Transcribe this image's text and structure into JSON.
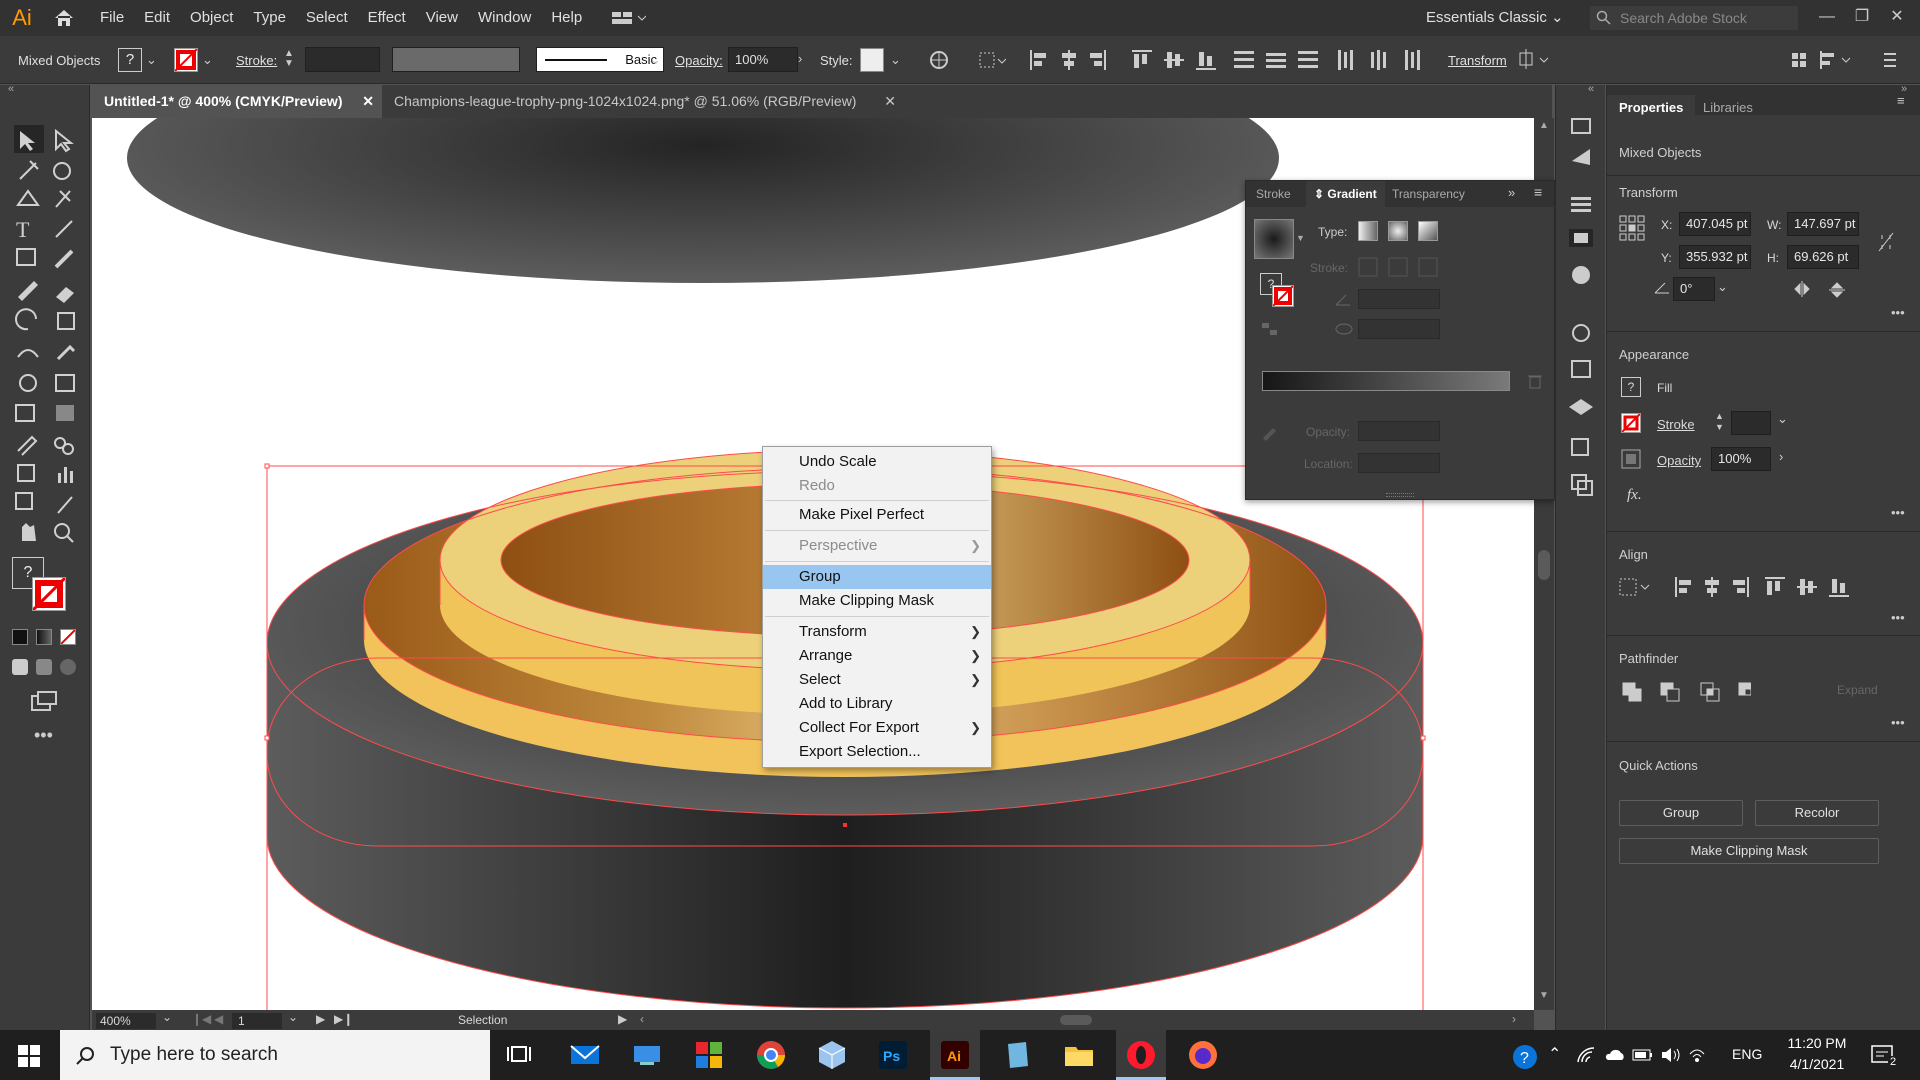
{
  "app": {
    "logo": "Ai"
  },
  "menubar": {
    "items": [
      "File",
      "Edit",
      "Object",
      "Type",
      "Select",
      "Effect",
      "View",
      "Window",
      "Help"
    ],
    "workspace": "Essentials Classic",
    "search_placeholder": "Search Adobe Stock"
  },
  "control_bar": {
    "selection": "Mixed Objects",
    "fill": "?",
    "stroke_label": "Stroke:",
    "brush": "Basic",
    "opacity_label": "Opacity:",
    "opacity": "100%",
    "style_label": "Style:",
    "transform": "Transform"
  },
  "tabs": [
    {
      "label": "Untitled-1* @ 400% (CMYK/Preview)",
      "active": true
    },
    {
      "label": "Champions-league-trophy-png-1024x1024.png* @ 51.06% (RGB/Preview)",
      "active": false
    }
  ],
  "context_menu": {
    "items": [
      {
        "label": "Undo Scale",
        "disabled": false,
        "submenu": false
      },
      {
        "label": "Redo",
        "disabled": true,
        "submenu": false
      },
      {
        "label": "Make Pixel Perfect",
        "disabled": false,
        "submenu": false
      },
      {
        "label": "Perspective",
        "disabled": true,
        "submenu": true
      },
      {
        "label": "Group",
        "disabled": false,
        "submenu": false,
        "selected": true
      },
      {
        "label": "Make Clipping Mask",
        "disabled": false,
        "submenu": false
      },
      {
        "label": "Transform",
        "disabled": false,
        "submenu": true
      },
      {
        "label": "Arrange",
        "disabled": false,
        "submenu": true
      },
      {
        "label": "Select",
        "disabled": false,
        "submenu": true
      },
      {
        "label": "Add to Library",
        "disabled": false,
        "submenu": false
      },
      {
        "label": "Collect For Export",
        "disabled": false,
        "submenu": true
      },
      {
        "label": "Export Selection...",
        "disabled": false,
        "submenu": false
      }
    ]
  },
  "gradient_panel": {
    "tabs": [
      "Stroke",
      "Gradient",
      "Transparency"
    ],
    "type_label": "Type:",
    "stroke_label": "Stroke:",
    "opacity_label": "Opacity:",
    "location_label": "Location:",
    "fill_q": "?"
  },
  "properties": {
    "tabs": [
      "Properties",
      "Libraries"
    ],
    "selection": "Mixed Objects",
    "transform": {
      "title": "Transform",
      "x_label": "X:",
      "x": "407.045 pt",
      "y_label": "Y:",
      "y": "355.932 pt",
      "w_label": "W:",
      "w": "147.697 pt",
      "h_label": "H:",
      "h": "69.626 pt",
      "angle": "0°"
    },
    "appearance": {
      "title": "Appearance",
      "fill_q": "?",
      "fill": "Fill",
      "stroke": "Stroke",
      "opacity_label": "Opacity",
      "opacity": "100%",
      "fx": "fx."
    },
    "align": {
      "title": "Align"
    },
    "pathfinder": {
      "title": "Pathfinder",
      "expand": "Expand"
    },
    "quick_actions": {
      "title": "Quick Actions",
      "group": "Group",
      "recolor": "Recolor",
      "clip": "Make Clipping Mask"
    }
  },
  "status": {
    "zoom": "400%",
    "artboard": "1",
    "tool": "Selection"
  },
  "toolbar": {
    "fill_q": "?"
  },
  "taskbar": {
    "search": "Type here to search",
    "lang": "ENG",
    "time": "11:20 PM",
    "date": "4/1/2021",
    "notif": "2"
  }
}
